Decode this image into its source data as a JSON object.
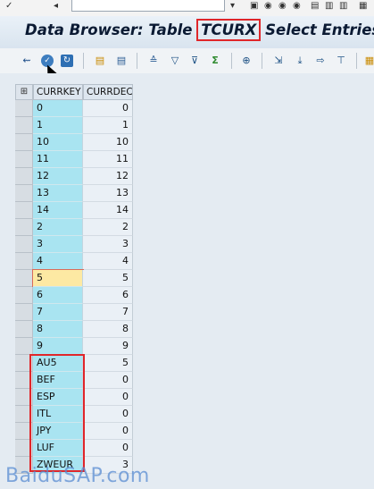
{
  "window": {
    "title_before": "Data Browser: Table ",
    "table_name": "TCURX",
    "title_after": " Select Entries"
  },
  "toolbar": {
    "icons": [
      "back-icon",
      "check-icon",
      "refresh-icon",
      "sort-asc-icon",
      "sort-desc-icon",
      "sum-icon",
      "filter-icon",
      "filter-off-icon",
      "total-icon",
      "details-icon",
      "export-icon",
      "download-icon",
      "print-icon",
      "layout-icon",
      "grid-icon"
    ]
  },
  "grid": {
    "columns": [
      "CURRKEY",
      "CURRDEC"
    ],
    "rows": [
      [
        "0",
        "0"
      ],
      [
        "1",
        "1"
      ],
      [
        "10",
        "10"
      ],
      [
        "11",
        "11"
      ],
      [
        "12",
        "12"
      ],
      [
        "13",
        "13"
      ],
      [
        "14",
        "14"
      ],
      [
        "2",
        "2"
      ],
      [
        "3",
        "3"
      ],
      [
        "4",
        "4"
      ],
      [
        "5",
        "5"
      ],
      [
        "6",
        "6"
      ],
      [
        "7",
        "7"
      ],
      [
        "8",
        "8"
      ],
      [
        "9",
        "9"
      ],
      [
        "AU5",
        "5"
      ],
      [
        "BEF",
        "0"
      ],
      [
        "ESP",
        "0"
      ],
      [
        "ITL",
        "0"
      ],
      [
        "JPY",
        "0"
      ],
      [
        "LUF",
        "0"
      ],
      [
        "ZWEUR",
        "3"
      ]
    ],
    "active_row": 10
  },
  "watermark": "BaiduSAP.com",
  "colors": {
    "key_column": "#a9e4f1",
    "highlight": "#e0262a",
    "active_cell": "#fde9a3"
  }
}
